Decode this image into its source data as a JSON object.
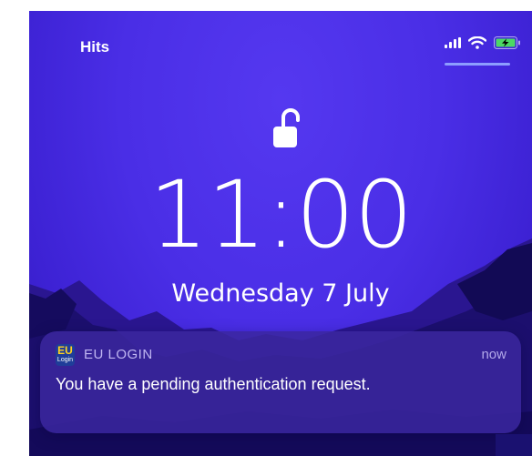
{
  "status_bar": {
    "carrier": "Hits"
  },
  "lock_screen": {
    "time": "11:00",
    "date": "Wednesday 7 July"
  },
  "notification": {
    "app_name": "EU LOGIN",
    "icon_text": "EU",
    "icon_subtext": "Login",
    "time": "now",
    "body": "You have a pending authentication request."
  },
  "colors": {
    "wallpaper": "#4a2ee6",
    "battery_charging": "#4cd964",
    "notification_bg": "#3a269e"
  }
}
